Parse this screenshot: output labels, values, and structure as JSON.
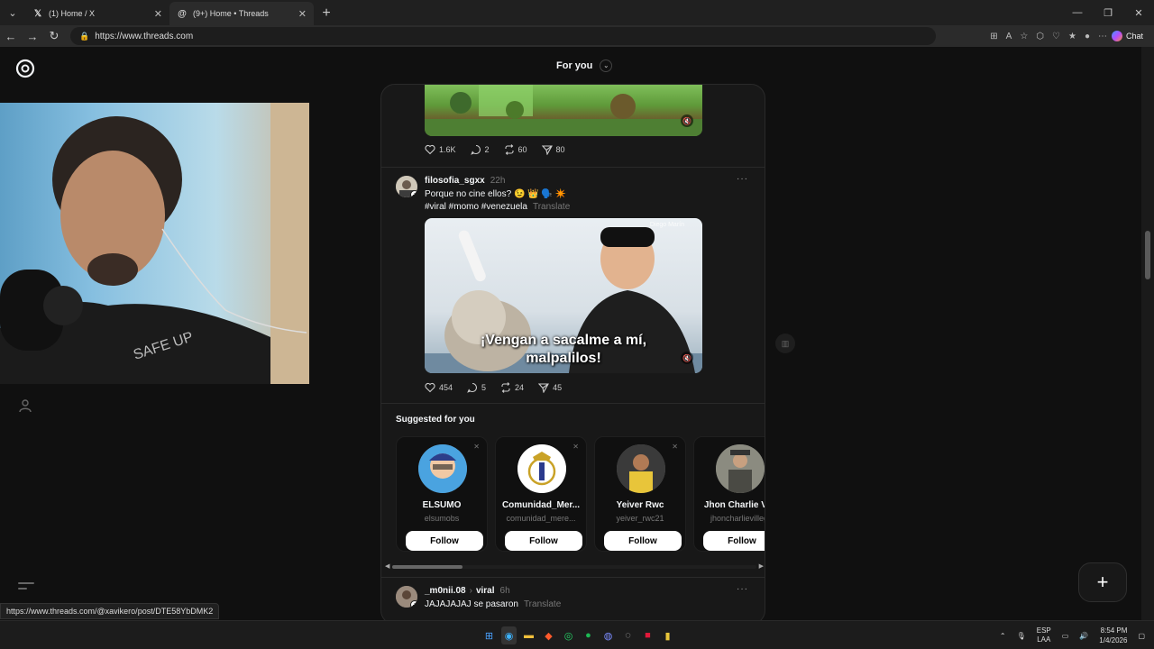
{
  "browser": {
    "tabs": [
      {
        "title": "(1) Home / X",
        "icon": "x-logo-icon"
      },
      {
        "title": "(9+) Home • Threads",
        "icon": "threads-logo-icon"
      }
    ],
    "url": "https://www.threads.com",
    "chat_label": "Chat"
  },
  "feed": {
    "header": "For you",
    "post1": {
      "likes": "1.6K",
      "replies": "2",
      "reposts": "60",
      "shares": "80"
    },
    "post2": {
      "username": "filosofia_sgxx",
      "time": "22h",
      "text": "Porque no cine ellos? 😉 👑 🗣️ ✴️",
      "hashtags": "#viral #momo #venezuela",
      "translate": "Translate",
      "watermark": "Diego Marín",
      "caption_line1": "¡Vengan a sacalme a mí,",
      "caption_line2": "malpalilos!",
      "likes": "454",
      "replies": "5",
      "reposts": "24",
      "shares": "45"
    },
    "suggested": {
      "title": "Suggested for you",
      "follow_label": "Follow",
      "users": [
        {
          "name": "ELSUMO",
          "handle": "elsumobs"
        },
        {
          "name": "Comunidad_Mer...",
          "handle": "comunidad_mere..."
        },
        {
          "name": "Yeiver Rwc",
          "handle": "yeiver_rwc21"
        },
        {
          "name": "Jhon Charlie Vill",
          "handle": "jhoncharlievilleg"
        }
      ]
    },
    "post3": {
      "username": "_m0nii.08",
      "topic": "viral",
      "time": "6h",
      "text": "JAJAJAJAJ se pasaron",
      "translate": "Translate"
    }
  },
  "status_url": "https://www.threads.com/@xavikero/post/DTE58YbDMK2",
  "taskbar": {
    "lang_line1": "ESP",
    "lang_line2": "LAA",
    "time": "8:54 PM",
    "date": "1/4/2026"
  },
  "colors": {
    "background": "#101010",
    "card": "#181818",
    "text": "#f3f5f7",
    "muted": "#777777"
  }
}
